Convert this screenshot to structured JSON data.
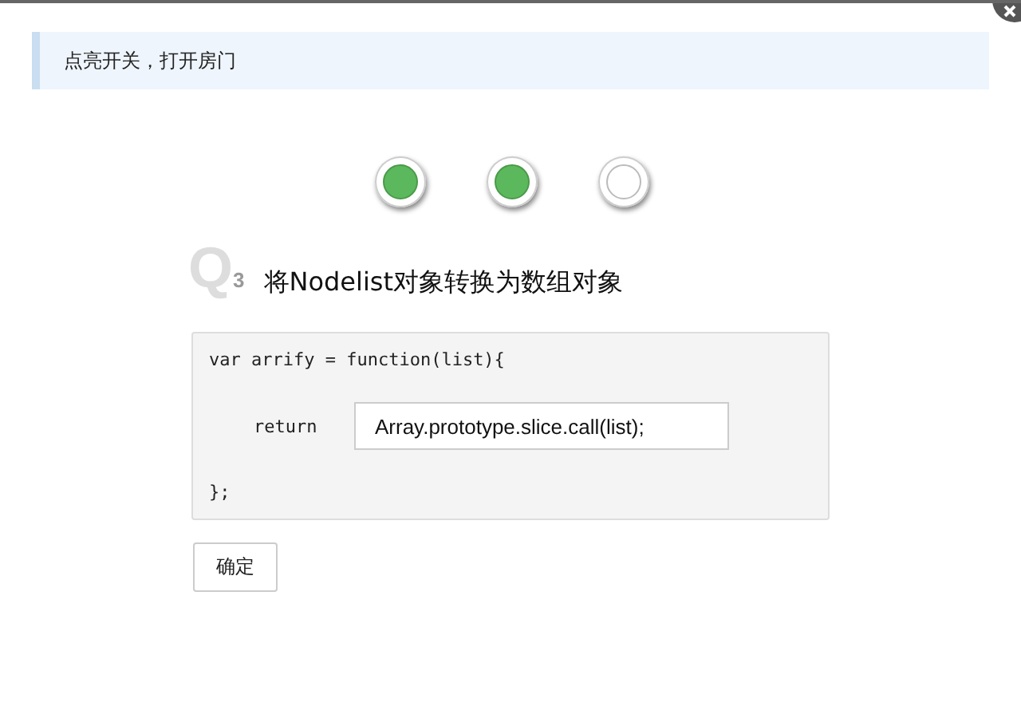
{
  "hint": "点亮开关，打开房门",
  "switches": [
    {
      "on": true
    },
    {
      "on": true
    },
    {
      "on": false
    }
  ],
  "question": {
    "letter": "Q",
    "index": "3",
    "title": "将Nodelist对象转换为数组对象"
  },
  "code": {
    "first_line": "var arrify = function(list){",
    "keyword": "return",
    "answer": "Array.prototype.slice.call(list);",
    "last_line": "};"
  },
  "submit": "确定"
}
